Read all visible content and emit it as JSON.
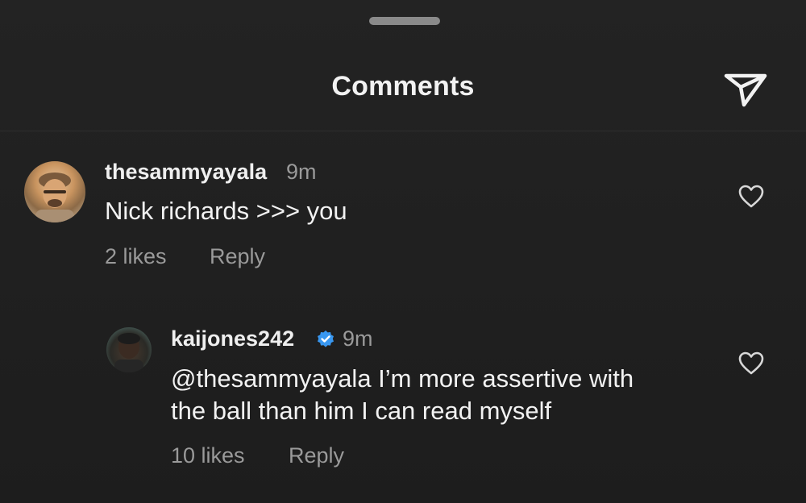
{
  "header": {
    "title": "Comments"
  },
  "icons": {
    "share": "paper-plane-icon",
    "like": "heart-outline-icon",
    "verified": "verified-badge-icon"
  },
  "colors": {
    "background": "#1f1f1f",
    "text_primary": "#f2f2f2",
    "text_secondary": "#9a9a9a",
    "verified_blue": "#3897f0"
  },
  "comments": [
    {
      "username": "thesammyayala",
      "time": "9m",
      "text": "Nick richards >>> you",
      "likes": "2 likes",
      "reply_label": "Reply"
    },
    {
      "username": "kaijones242",
      "verified": true,
      "time": "9m",
      "text_line1": "@thesammyayala I’m more assertive with",
      "text_line2": "the ball than him I can read myself",
      "likes": "10 likes",
      "reply_label": "Reply"
    }
  ]
}
